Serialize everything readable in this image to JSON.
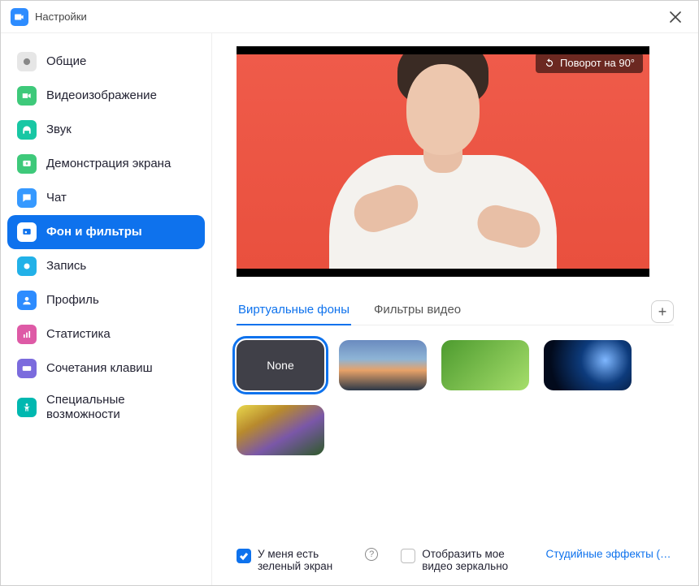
{
  "window": {
    "title": "Настройки"
  },
  "sidebar": {
    "items": [
      {
        "label": "Общие"
      },
      {
        "label": "Видеоизображение"
      },
      {
        "label": "Звук"
      },
      {
        "label": "Демонстрация экрана"
      },
      {
        "label": "Чат"
      },
      {
        "label": "Фон и фильтры"
      },
      {
        "label": "Запись"
      },
      {
        "label": "Профиль"
      },
      {
        "label": "Статистика"
      },
      {
        "label": "Сочетания клавиш"
      },
      {
        "label": "Специальные возможности"
      }
    ],
    "active_index": 5
  },
  "preview": {
    "rotate_label": "Поворот на 90°"
  },
  "tabs": {
    "virtual_bg": "Виртуальные фоны",
    "video_filters": "Фильтры видео",
    "active": "virtual_bg"
  },
  "backgrounds": {
    "none_label": "None",
    "selected": "none",
    "items": [
      "none",
      "bridge",
      "grass",
      "earth",
      "flowers"
    ]
  },
  "footer": {
    "green_screen_label": "У меня есть зеленый экран",
    "green_screen_checked": true,
    "mirror_label": "Отобразить мое видео зеркально",
    "mirror_checked": false,
    "studio_link": "Студийные эффекты (бета-..."
  }
}
